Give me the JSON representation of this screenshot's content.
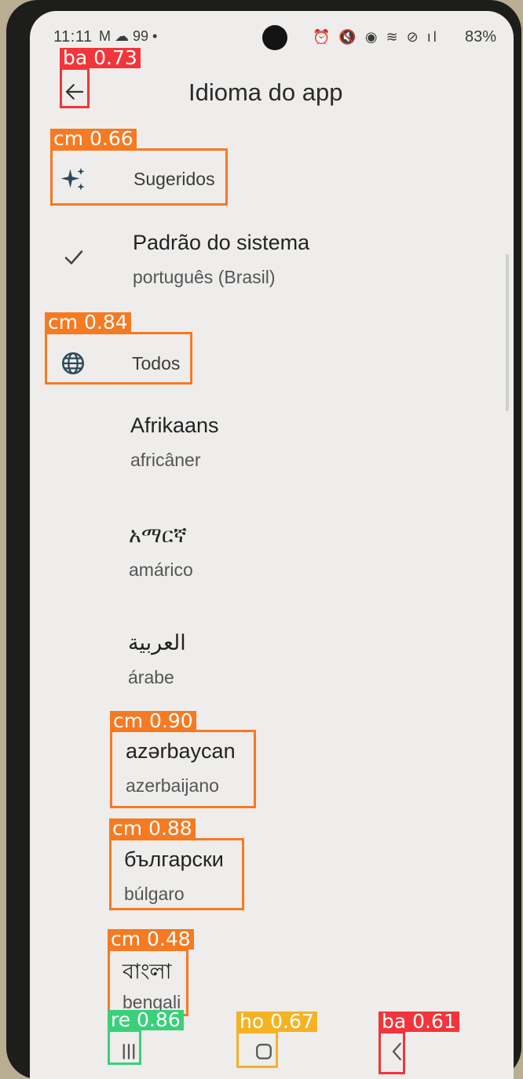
{
  "status_bar": {
    "time": "11:11",
    "left_icons": "M ☁ 99 •",
    "right_icons": "⏰ 🔇 ◉ ≋ ⊘ ıl",
    "battery": "83%"
  },
  "app_bar": {
    "title": "Idioma do app"
  },
  "suggested": {
    "header": "Sugeridos"
  },
  "system_default": {
    "primary": "Padrão do sistema",
    "secondary": "português (Brasil)"
  },
  "all": {
    "header": "Todos"
  },
  "languages": [
    {
      "primary": "Afrikaans",
      "secondary": "africâner"
    },
    {
      "primary": "አማርኛ",
      "secondary": "amárico"
    },
    {
      "primary": "العربية",
      "secondary": "árabe"
    },
    {
      "primary": "azərbaycan",
      "secondary": "azerbaijano"
    },
    {
      "primary": "български",
      "secondary": "búlgaro"
    },
    {
      "primary": "বাংলা",
      "secondary": "bengali"
    }
  ],
  "detections": [
    {
      "label": "ba 0.73",
      "color": "#f2353a"
    },
    {
      "label": "cm 0.66",
      "color": "#f57a22"
    },
    {
      "label": "cm 0.84",
      "color": "#f57a22"
    },
    {
      "label": "cm 0.90",
      "color": "#f57a22"
    },
    {
      "label": "cm 0.88",
      "color": "#f57a22"
    },
    {
      "label": "cm 0.48",
      "color": "#f57a22"
    },
    {
      "label": "re 0.86",
      "color": "#3ad07a"
    },
    {
      "label": "ho 0.67",
      "color": "#f5b223"
    },
    {
      "label": "ba 0.61",
      "color": "#f2353a"
    }
  ],
  "colors": {
    "screen_bg": "#eeedeb",
    "accent_icon": "#2b4a5c"
  },
  "icons": {
    "back": "arrow-left-icon",
    "suggested": "sparkle-icon",
    "check": "check-icon",
    "all": "globe-icon",
    "recents": "recents-icon",
    "home": "home-icon",
    "nav_back": "chevron-left-icon"
  }
}
